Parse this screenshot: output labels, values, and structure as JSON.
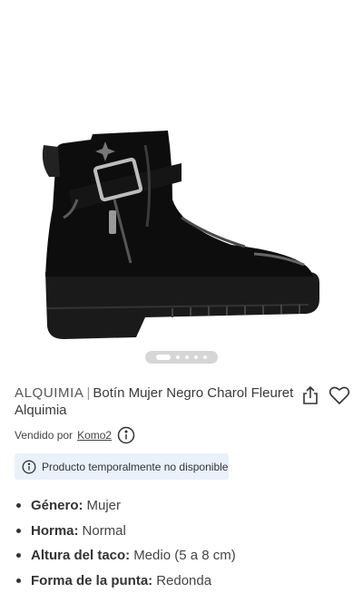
{
  "product": {
    "brand": "ALQUIMIA",
    "separator": "|",
    "name": "Botín Mujer Negro Charol Fleuret Alquimia",
    "seller_prefix": "Vendido por",
    "seller_name": "Komo2"
  },
  "availability": {
    "message": "Producto temporalmente no disponible"
  },
  "attributes": [
    {
      "label": "Género:",
      "value": "Mujer"
    },
    {
      "label": "Horma:",
      "value": "Normal"
    },
    {
      "label": "Altura del taco:",
      "value": "Medio (5 a 8 cm)"
    },
    {
      "label": "Forma de la punta:",
      "value": "Redonda"
    }
  ],
  "gallery": {
    "image_count": 5,
    "active_index": 0
  },
  "icons": {
    "share": "share-icon",
    "favorite": "heart-icon",
    "info": "info-icon"
  },
  "colors": {
    "banner_bg": "#e9f1fb",
    "indicator_bg": "#d6d6d6"
  }
}
